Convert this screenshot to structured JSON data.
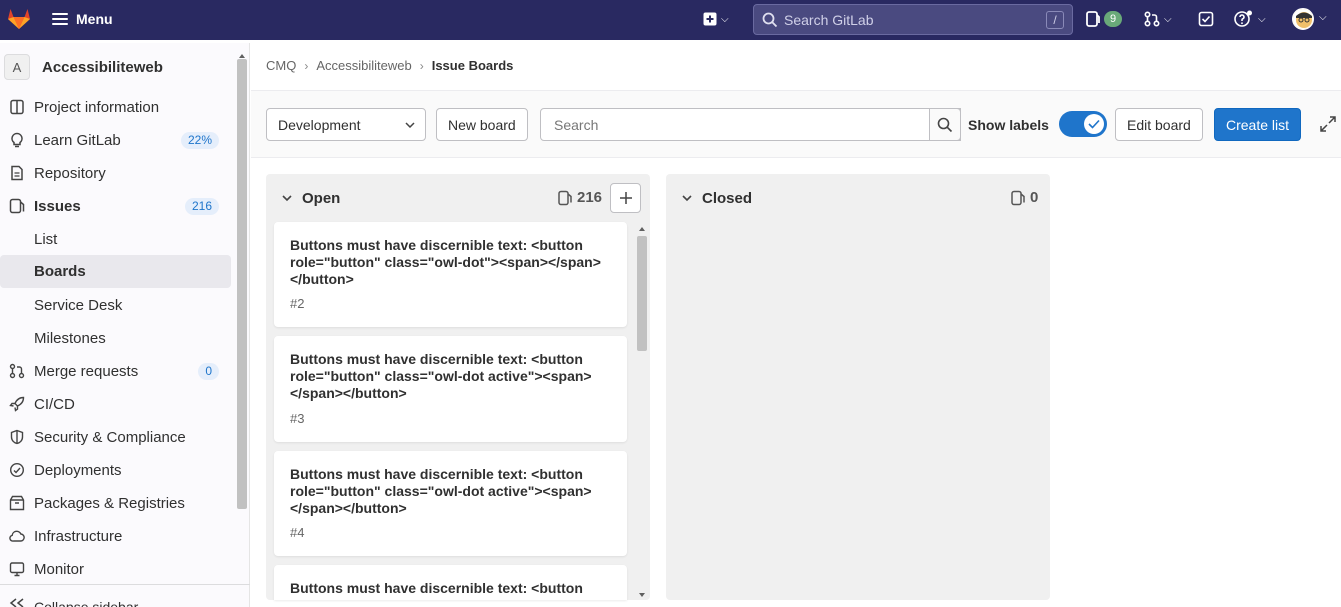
{
  "topbar": {
    "menu_label": "Menu",
    "search_placeholder": "Search GitLab",
    "search_shortcut": "/",
    "issues_count": "9"
  },
  "sidebar": {
    "project_initial": "A",
    "project_name": "Accessibiliteweb",
    "items": [
      {
        "label": "Project information"
      },
      {
        "label": "Learn GitLab",
        "badge": "22%"
      },
      {
        "label": "Repository"
      },
      {
        "label": "Issues",
        "badge": "216"
      },
      {
        "label": "List"
      },
      {
        "label": "Boards"
      },
      {
        "label": "Service Desk"
      },
      {
        "label": "Milestones"
      },
      {
        "label": "Merge requests",
        "badge": "0"
      },
      {
        "label": "CI/CD"
      },
      {
        "label": "Security & Compliance"
      },
      {
        "label": "Deployments"
      },
      {
        "label": "Packages & Registries"
      },
      {
        "label": "Infrastructure"
      },
      {
        "label": "Monitor"
      }
    ],
    "collapse_label": "Collapse sidebar"
  },
  "breadcrumb": [
    "CMQ",
    "Accessibiliteweb",
    "Issue Boards"
  ],
  "board_bar": {
    "board_select": "Development",
    "new_board": "New board",
    "search_placeholder": "Search",
    "show_labels": "Show labels",
    "show_labels_on": true,
    "edit_board": "Edit board",
    "create_list": "Create list"
  },
  "lists": [
    {
      "title": "Open",
      "count": "216",
      "cards": [
        {
          "title": "Buttons must have discernible text: <button role=\"button\" class=\"owl-dot\"><span></span></button>",
          "number": "#2"
        },
        {
          "title": "Buttons must have discernible text: <button role=\"button\" class=\"owl-dot active\"><span></span></button>",
          "number": "#3"
        },
        {
          "title": "Buttons must have discernible text: <button role=\"button\" class=\"owl-dot active\"><span></span></button>",
          "number": "#4"
        },
        {
          "title": "Buttons must have discernible text: <button",
          "number": ""
        }
      ]
    },
    {
      "title": "Closed",
      "count": "0",
      "cards": []
    }
  ],
  "colors": {
    "topbar": "#292961",
    "primary": "#1f75cb",
    "list_bg": "#f0f0f0"
  }
}
